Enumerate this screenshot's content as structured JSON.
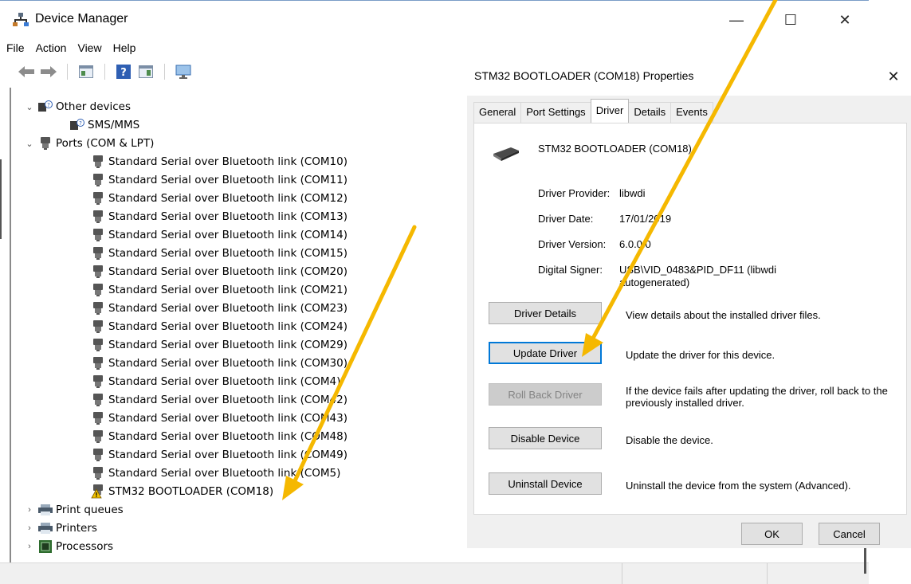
{
  "device_manager": {
    "title": "Device Manager",
    "menu": [
      "File",
      "Action",
      "View",
      "Help"
    ],
    "toolbar_icons": [
      "back-icon",
      "forward-icon",
      "properties-window-icon",
      "help-icon",
      "list-view-icon",
      "monitor-icon"
    ],
    "tree": {
      "other_devices": {
        "label": "Other devices",
        "children": [
          "SMS/MMS"
        ]
      },
      "ports": {
        "label": "Ports (COM & LPT)",
        "children": [
          "Standard Serial over Bluetooth link (COM10)",
          "Standard Serial over Bluetooth link (COM11)",
          "Standard Serial over Bluetooth link (COM12)",
          "Standard Serial over Bluetooth link (COM13)",
          "Standard Serial over Bluetooth link (COM14)",
          "Standard Serial over Bluetooth link (COM15)",
          "Standard Serial over Bluetooth link (COM20)",
          "Standard Serial over Bluetooth link (COM21)",
          "Standard Serial over Bluetooth link (COM23)",
          "Standard Serial over Bluetooth link (COM24)",
          "Standard Serial over Bluetooth link (COM29)",
          "Standard Serial over Bluetooth link (COM30)",
          "Standard Serial over Bluetooth link (COM4)",
          "Standard Serial over Bluetooth link (COM42)",
          "Standard Serial over Bluetooth link (COM43)",
          "Standard Serial over Bluetooth link (COM48)",
          "Standard Serial over Bluetooth link (COM49)",
          "Standard Serial over Bluetooth link (COM5)",
          "STM32  BOOTLOADER (COM18)"
        ]
      },
      "collapsed": [
        "Print queues",
        "Printers",
        "Processors"
      ]
    }
  },
  "properties": {
    "title": "STM32  BOOTLOADER (COM18) Properties",
    "tabs": [
      "General",
      "Port Settings",
      "Driver",
      "Details",
      "Events"
    ],
    "active_tab": "Driver",
    "device_name": "STM32  BOOTLOADER (COM18)",
    "info": {
      "provider_label": "Driver Provider:",
      "provider_value": "libwdi",
      "date_label": "Driver Date:",
      "date_value": "17/01/2019",
      "version_label": "Driver Version:",
      "version_value": "6.0.0.0",
      "signer_label": "Digital Signer:",
      "signer_value": "USB\\VID_0483&PID_DF11 (libwdi autogenerated)"
    },
    "actions": [
      {
        "button": "Driver Details",
        "description": "View details about the installed driver files."
      },
      {
        "button": "Update Driver",
        "description": "Update the driver for this device."
      },
      {
        "button": "Roll Back Driver",
        "description": "If the device fails after updating the driver, roll back to the previously installed driver."
      },
      {
        "button": "Disable Device",
        "description": "Disable the device."
      },
      {
        "button": "Uninstall Device",
        "description": "Uninstall the device from the system (Advanced)."
      }
    ],
    "ok_label": "OK",
    "cancel_label": "Cancel"
  },
  "colors": {
    "annotation_arrow": "#f5b800",
    "focus_blue": "#0078d7",
    "warning_yellow": "#f2c200"
  }
}
